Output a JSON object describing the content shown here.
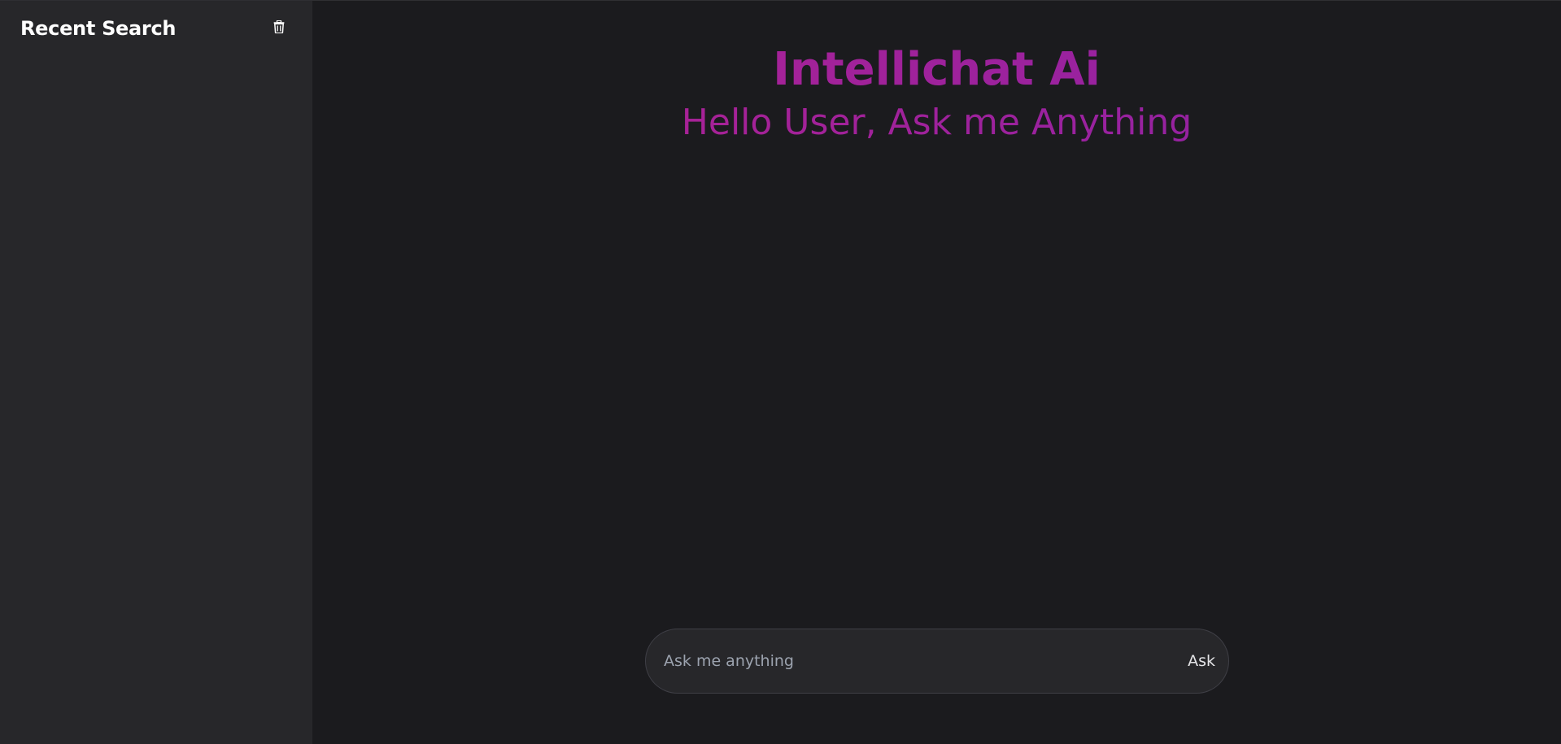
{
  "sidebar": {
    "title": "Recent Search",
    "clear_icon": "trash-icon",
    "items": []
  },
  "main": {
    "title": "Intellichat Ai",
    "subtitle": "Hello User, Ask me Anything"
  },
  "ask_bar": {
    "placeholder": "Ask me anything",
    "value": "",
    "button_label": "Ask"
  },
  "colors": {
    "background": "#1b1b1e",
    "sidebar": "#27272a",
    "accent_start": "#b3228f",
    "accent_end": "#8a22a8",
    "input_border": "#3f3f46"
  }
}
